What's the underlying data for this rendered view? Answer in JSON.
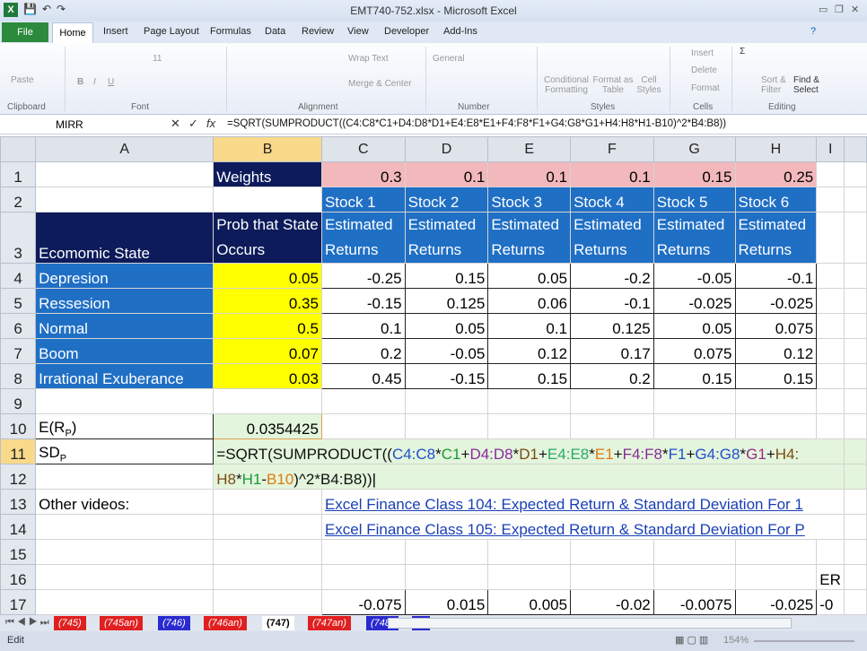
{
  "window": {
    "title": "EMT740-752.xlsx - Microsoft Excel"
  },
  "ribbon_tabs": [
    "File",
    "Home",
    "Insert",
    "Page Layout",
    "Formulas",
    "Data",
    "Review",
    "View",
    "Developer",
    "Add-Ins"
  ],
  "ribbon": {
    "paste": "Paste",
    "clipboard": "Clipboard",
    "font_size": "11",
    "font": "Font",
    "wrap_text": "Wrap Text",
    "merge_center": "Merge & Center",
    "alignment": "Alignment",
    "number_format": "General",
    "number": "Number",
    "conditional": "Conditional Formatting",
    "format_table": "Format as Table",
    "cell_styles": "Cell Styles",
    "styles": "Styles",
    "insert": "Insert",
    "delete": "Delete",
    "format": "Format",
    "cells": "Cells",
    "sort_filter": "Sort & Filter",
    "find_select": "Find & Select",
    "editing": "Editing"
  },
  "formula_bar": {
    "name_box": "MIRR",
    "formula": "=SQRT(SUMPRODUCT((C4:C8*C1+D4:D8*D1+E4:E8*E1+F4:F8*F1+G4:G8*G1+H4:H8*H1-B10)^2*B4:B8))"
  },
  "columns": [
    "A",
    "B",
    "C",
    "D",
    "E",
    "F",
    "G",
    "H",
    "I"
  ],
  "cells": {
    "A3": "Ecomomic State",
    "B1": "Weights",
    "B3": "Prob that State Occurs",
    "row1": [
      "0.3",
      "0.1",
      "0.1",
      "0.1",
      "0.15",
      "0.25"
    ],
    "row2": [
      "Stock 1",
      "Stock 2",
      "Stock 3",
      "Stock 4",
      "Stock 5",
      "Stock 6"
    ],
    "row3": "Estimated Returns",
    "states": [
      {
        "name": "Depresion",
        "prob": "0.05",
        "returns": [
          "-0.25",
          "0.15",
          "0.05",
          "-0.2",
          "-0.05",
          "-0.1"
        ]
      },
      {
        "name": "Ressesion",
        "prob": "0.35",
        "returns": [
          "-0.15",
          "0.125",
          "0.06",
          "-0.1",
          "-0.025",
          "-0.025"
        ]
      },
      {
        "name": "Normal",
        "prob": "0.5",
        "returns": [
          "0.1",
          "0.05",
          "0.1",
          "0.125",
          "0.05",
          "0.075"
        ]
      },
      {
        "name": "Boom",
        "prob": "0.07",
        "returns": [
          "0.2",
          "-0.05",
          "0.12",
          "0.17",
          "0.075",
          "0.12"
        ]
      },
      {
        "name": "Irrational Exuberance",
        "prob": "0.03",
        "returns": [
          "0.45",
          "-0.15",
          "0.15",
          "0.2",
          "0.15",
          "0.15"
        ]
      }
    ],
    "A10": "E(R",
    "A10_sub": "P",
    "A10_end": ")",
    "B10": "0.0354425",
    "A11": "SD",
    "A11_sub": "P",
    "A13": "Other videos:",
    "C13": "Excel Finance Class 104: Expected Return & Standard Deviation For 1",
    "C14": "Excel Finance Class 105: Expected Return & Standard Deviation For P",
    "I16": "ER",
    "row17": [
      "-0.075",
      "0.015",
      "0.005",
      "-0.02",
      "-0.0075",
      "-0.025",
      "-0"
    ]
  },
  "edit_formula": [
    {
      "t": "=SQRT(SUMPRODUCT((",
      "c": "#111"
    },
    {
      "t": "C4:C8",
      "c": "#1f4fd0"
    },
    {
      "t": "*",
      "c": "#111"
    },
    {
      "t": "C1",
      "c": "#1a9a3a"
    },
    {
      "t": "+",
      "c": "#111"
    },
    {
      "t": "D4:D8",
      "c": "#8a2aa0"
    },
    {
      "t": "*",
      "c": "#111"
    },
    {
      "t": "D1",
      "c": "#7a4a10"
    },
    {
      "t": "+",
      "c": "#111"
    },
    {
      "t": "E4:E8",
      "c": "#2aaa6a"
    },
    {
      "t": "*",
      "c": "#111"
    },
    {
      "t": "E1",
      "c": "#e07a10"
    },
    {
      "t": "+",
      "c": "#111"
    },
    {
      "t": "F4:F8",
      "c": "#8a2a9a"
    },
    {
      "t": "*",
      "c": "#111"
    },
    {
      "t": "F1",
      "c": "#1f4fd0"
    },
    {
      "t": "+",
      "c": "#111"
    },
    {
      "t": "G4:G8",
      "c": "#1f4fd0"
    },
    {
      "t": "*",
      "c": "#111"
    },
    {
      "t": "G1",
      "c": "#9a2a8a"
    },
    {
      "t": "+",
      "c": "#111"
    },
    {
      "t": "H4:",
      "c": "#7a4a10"
    }
  ],
  "edit_formula_2": [
    {
      "t": "H8",
      "c": "#7a4a10"
    },
    {
      "t": "*",
      "c": "#111"
    },
    {
      "t": "H1",
      "c": "#1a9a3a"
    },
    {
      "t": "-",
      "c": "#111"
    },
    {
      "t": "B10",
      "c": "#e07a10"
    },
    {
      "t": ")^2*B4:B8))",
      "c": "#111"
    }
  ],
  "sheet_tabs": [
    {
      "label": "(745)",
      "color": "#e02020"
    },
    {
      "label": "(745an)",
      "color": "#e02020"
    },
    {
      "label": "(746)",
      "color": "#2a2ad0"
    },
    {
      "label": "(746an)",
      "color": "#e02020"
    },
    {
      "label": "(747)",
      "color": "#ffffff",
      "active": true
    },
    {
      "label": "(747an)",
      "color": "#e02020"
    },
    {
      "label": "(748)",
      "color": "#2a2ad0"
    },
    {
      "label": "(7",
      "color": "#2a2ad0"
    }
  ],
  "status": {
    "mode": "Edit",
    "zoom": "154%"
  }
}
